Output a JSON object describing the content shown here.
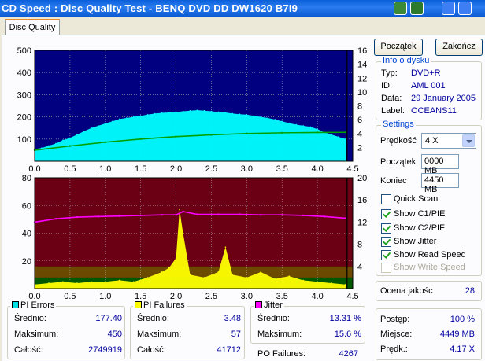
{
  "window": {
    "title": "CD Speed : Disc Quality Test - BENQ     DVD DD DW1620     B7I9"
  },
  "tabs": [
    {
      "label": "Disc Quality"
    }
  ],
  "buttons": {
    "start": "Początek",
    "end": "Zakończ"
  },
  "disc_info": {
    "title": "Info o dysku",
    "rows": [
      {
        "label": "Typ:",
        "value": "DVD+R"
      },
      {
        "label": "ID:",
        "value": "AML 001"
      },
      {
        "label": "Data:",
        "value": "29 January 2005"
      },
      {
        "label": "Label:",
        "value": "OCEANS11"
      }
    ]
  },
  "settings": {
    "title": "Settings",
    "speed_label": "Prędkość",
    "speed_value": "4 X",
    "start_label": "Początek",
    "start_value": "0000 MB",
    "end_label": "Koniec",
    "end_value": "4450 MB",
    "checkboxes": [
      {
        "label": "Quick Scan",
        "checked": false,
        "disabled": false
      },
      {
        "label": "Show C1/PIE",
        "checked": true,
        "disabled": false
      },
      {
        "label": "Show C2/PIF",
        "checked": true,
        "disabled": false
      },
      {
        "label": "Show Jitter",
        "checked": true,
        "disabled": false
      },
      {
        "label": "Show Read Speed",
        "checked": true,
        "disabled": false
      },
      {
        "label": "Show Write Speed",
        "checked": true,
        "disabled": true
      }
    ]
  },
  "quality": {
    "label": "Ocena jakośc",
    "value": "28"
  },
  "progress": {
    "rows": [
      {
        "label": "Postęp:",
        "value": "100 %"
      },
      {
        "label": "Miejsce:",
        "value": "4449 MB"
      },
      {
        "label": "Prędk.:",
        "value": "4.17 X"
      }
    ]
  },
  "stats": {
    "pi_errors": {
      "title": "PI Errors",
      "color": "#00e0e0",
      "rows": [
        {
          "label": "Średnio:",
          "value": "177.40"
        },
        {
          "label": "Maksimum:",
          "value": "450"
        },
        {
          "label": "Całość:",
          "value": "2749919"
        }
      ]
    },
    "pi_failures": {
      "title": "PI Failures",
      "color": "#ffff00",
      "rows": [
        {
          "label": "Średnio:",
          "value": "3.48"
        },
        {
          "label": "Maksimum:",
          "value": "57"
        },
        {
          "label": "Całość:",
          "value": "41712"
        }
      ]
    },
    "jitter": {
      "title": "Jitter",
      "color": "#ff00ff",
      "rows": [
        {
          "label": "Średnio:",
          "value": "13.31 %"
        },
        {
          "label": "Maksimum:",
          "value": "15.6 %"
        }
      ]
    },
    "po_failures": {
      "label": "PO Failures:",
      "value": "4267"
    }
  },
  "chart_data": [
    {
      "type": "area",
      "x_ticks": [
        "0.0",
        "0.5",
        "1.0",
        "1.5",
        "2.0",
        "2.5",
        "3.0",
        "3.5",
        "4.0",
        "4.5"
      ],
      "y_left_ticks": [
        "100",
        "200",
        "300",
        "400",
        "500"
      ],
      "y_right_ticks": [
        "2",
        "4",
        "6",
        "8",
        "10",
        "12",
        "14",
        "16"
      ],
      "xlim": [
        0,
        4.5
      ],
      "ylim_left": [
        0,
        500
      ],
      "ylim_right": [
        0,
        16
      ],
      "series": [
        {
          "color": "#00ffff",
          "x": [
            0.0,
            0.1,
            0.2,
            0.3,
            0.4,
            0.5,
            0.6,
            0.7,
            0.8,
            0.9,
            1.0,
            1.1,
            1.2,
            1.3,
            1.4,
            1.5,
            1.6,
            1.7,
            1.8,
            1.9,
            2.0,
            2.1,
            2.2,
            2.3,
            2.4,
            2.5,
            2.6,
            2.7,
            2.8,
            2.9,
            3.0,
            3.1,
            3.2,
            3.3,
            3.4,
            3.5,
            3.6,
            3.7,
            3.8,
            3.9,
            4.0,
            4.1,
            4.2,
            4.3,
            4.4
          ],
          "y": [
            55,
            60,
            70,
            80,
            95,
            105,
            120,
            135,
            150,
            160,
            170,
            180,
            190,
            195,
            200,
            205,
            210,
            215,
            218,
            220,
            222,
            225,
            228,
            230,
            228,
            225,
            222,
            220,
            215,
            212,
            210,
            205,
            200,
            195,
            188,
            180,
            172,
            165,
            160,
            155,
            145,
            130,
            120,
            110,
            100
          ]
        },
        {
          "color": "#00a000",
          "x": [
            0.0,
            0.5,
            1.0,
            1.5,
            2.0,
            2.5,
            3.0,
            3.5,
            4.0,
            4.4
          ],
          "y": [
            1.6,
            2.2,
            2.75,
            3.2,
            3.55,
            3.8,
            4.0,
            4.1,
            4.15,
            4.17
          ]
        }
      ]
    },
    {
      "type": "area",
      "x_ticks": [
        "0.0",
        "0.5",
        "1.0",
        "1.5",
        "2.0",
        "2.5",
        "3.0",
        "3.5",
        "4.0",
        "4.5"
      ],
      "y_left_ticks": [
        "20",
        "40",
        "60",
        "80"
      ],
      "y_right_ticks": [
        "4",
        "8",
        "12",
        "16",
        "20"
      ],
      "xlim": [
        0,
        4.5
      ],
      "ylim_left": [
        0,
        80
      ],
      "ylim_right": [
        0,
        20
      ],
      "series": [
        {
          "color": "#ffff00",
          "x": [
            0.0,
            0.2,
            0.4,
            0.6,
            0.8,
            1.0,
            1.2,
            1.4,
            1.6,
            1.8,
            1.9,
            2.0,
            2.05,
            2.1,
            2.2,
            2.4,
            2.6,
            2.7,
            2.8,
            3.0,
            3.2,
            3.4,
            3.6,
            3.8,
            4.0,
            4.2,
            4.4
          ],
          "y": [
            3,
            4,
            5,
            4,
            5,
            5,
            6,
            5,
            8,
            12,
            15,
            22,
            57,
            40,
            10,
            8,
            12,
            30,
            10,
            8,
            12,
            7,
            9,
            6,
            5,
            4,
            3
          ]
        },
        {
          "color": "#ff00ff",
          "x": [
            0.0,
            0.3,
            0.6,
            0.9,
            1.2,
            1.5,
            1.8,
            2.0,
            2.1,
            2.3,
            2.6,
            2.9,
            3.2,
            3.5,
            3.8,
            4.1,
            4.4
          ],
          "y": [
            12.0,
            12.6,
            12.9,
            13.0,
            13.1,
            13.2,
            13.3,
            13.3,
            13.9,
            13.4,
            13.4,
            13.4,
            13.3,
            13.3,
            13.2,
            13.0,
            12.7
          ]
        }
      ]
    }
  ]
}
